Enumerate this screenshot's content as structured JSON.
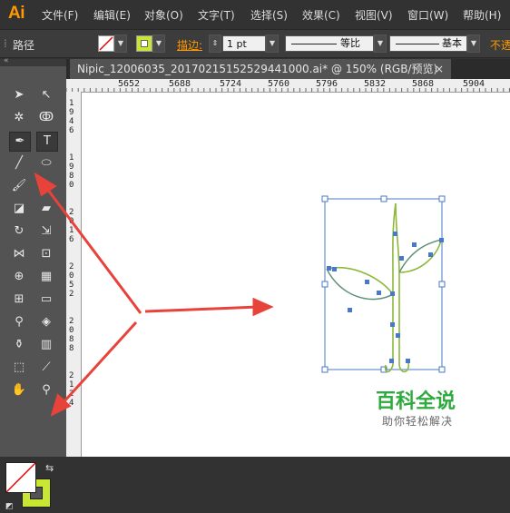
{
  "app": {
    "logo": "Ai"
  },
  "menu": [
    "文件(F)",
    "编辑(E)",
    "对象(O)",
    "文字(T)",
    "选择(S)",
    "效果(C)",
    "视图(V)",
    "窗口(W)",
    "帮助(H)"
  ],
  "control_bar": {
    "selection_label": "路径",
    "stroke_label": "描边:",
    "stroke_weight": "1 pt",
    "profile_uniform": "等比",
    "brush_basic": "基本",
    "opacity_label": "不透"
  },
  "tab": {
    "title": "Nipic_12006035_20170215152529441000.ai*  @  150%  (RGB/预览)",
    "close": "×"
  },
  "ruler": {
    "h_labels": [
      "5652",
      "5688",
      "5724",
      "5760",
      "5796",
      "5832",
      "5868",
      "5904"
    ],
    "v_labels": [
      "1\n9\n4\n6",
      "1\n9\n8\n0",
      "2\n0\n1\n6",
      "2\n0\n5\n2",
      "2\n0\n8\n8",
      "2\n1\n2\n4"
    ]
  },
  "tools": [
    {
      "name": "selection-tool",
      "glyph": "➤"
    },
    {
      "name": "direct-selection-tool",
      "glyph": "↖"
    },
    {
      "name": "magic-wand-tool",
      "glyph": "✲"
    },
    {
      "name": "lasso-tool",
      "glyph": "ↂ"
    },
    {
      "name": "pen-tool",
      "glyph": "✒"
    },
    {
      "name": "type-tool",
      "glyph": "T"
    },
    {
      "name": "line-tool",
      "glyph": "╱"
    },
    {
      "name": "ellipse-tool",
      "glyph": "⬭"
    },
    {
      "name": "paintbrush-tool",
      "glyph": "🖌"
    },
    {
      "name": "pencil-tool",
      "glyph": "✎"
    },
    {
      "name": "blob-brush-tool",
      "glyph": "◪"
    },
    {
      "name": "eraser-tool",
      "glyph": "▰"
    },
    {
      "name": "rotate-tool",
      "glyph": "↻"
    },
    {
      "name": "scale-tool",
      "glyph": "⇲"
    },
    {
      "name": "width-tool",
      "glyph": "⋈"
    },
    {
      "name": "free-transform-tool",
      "glyph": "⊡"
    },
    {
      "name": "shape-builder-tool",
      "glyph": "⊕"
    },
    {
      "name": "perspective-grid-tool",
      "glyph": "▦"
    },
    {
      "name": "mesh-tool",
      "glyph": "⊞"
    },
    {
      "name": "gradient-tool",
      "glyph": "▭"
    },
    {
      "name": "eyedropper-tool",
      "glyph": "⚲"
    },
    {
      "name": "blend-tool",
      "glyph": "◈"
    },
    {
      "name": "symbol-sprayer-tool",
      "glyph": "⚱"
    },
    {
      "name": "column-graph-tool",
      "glyph": "▥"
    },
    {
      "name": "artboard-tool",
      "glyph": "⬚"
    },
    {
      "name": "slice-tool",
      "glyph": "⟋"
    },
    {
      "name": "hand-tool",
      "glyph": "✋"
    },
    {
      "name": "zoom-tool",
      "glyph": "⚲"
    }
  ],
  "colors": {
    "stroke_swatch": "#c8e632",
    "selection": "#4a78c8",
    "path": "#8db83b",
    "arrow": "#e8433a"
  },
  "watermark": {
    "title": "百科全说",
    "subtitle": "助你轻松解决"
  }
}
